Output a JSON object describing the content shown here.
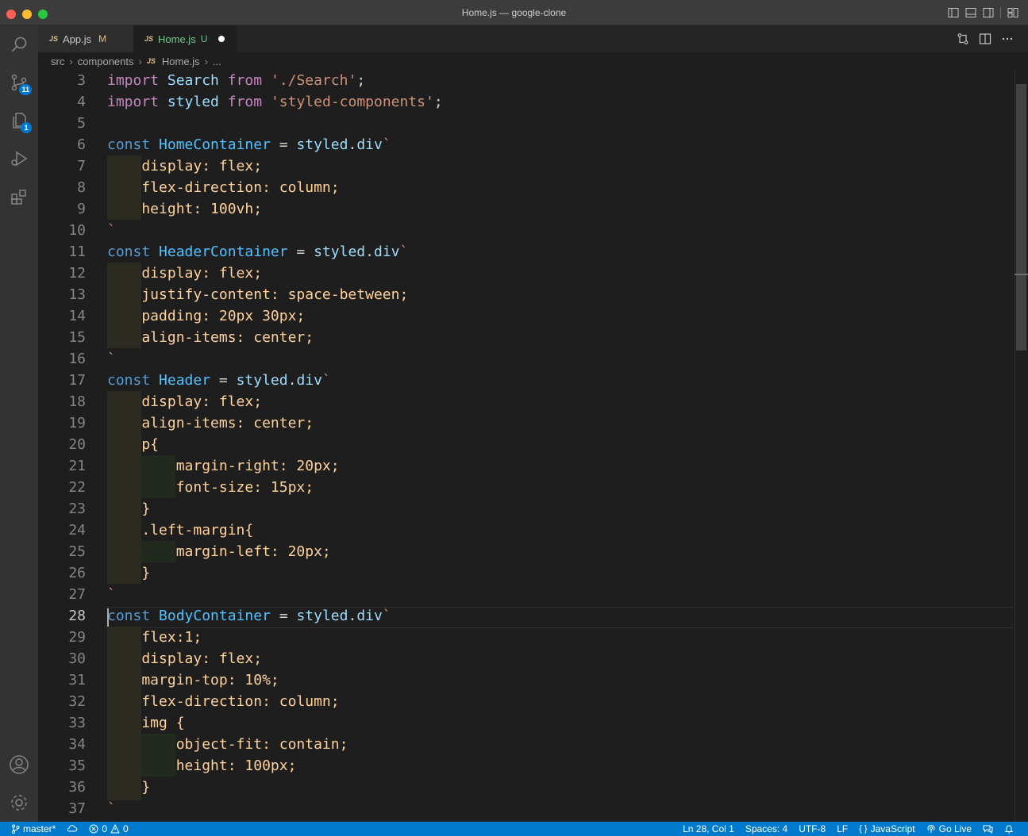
{
  "window": {
    "title": "Home.js — google-clone"
  },
  "activity_bar": {
    "source_control_badge": "11",
    "explorer_badge": "1"
  },
  "tabs": [
    {
      "label": "App.js",
      "status": "M",
      "icon": "JS"
    },
    {
      "label": "Home.js",
      "status": "U",
      "icon": "JS",
      "dirty": true
    }
  ],
  "breadcrumb": {
    "parts": [
      "src",
      "components",
      "Home.js",
      "..."
    ]
  },
  "editor": {
    "active_line": 28,
    "line_numbers": [
      "3",
      "4",
      "5",
      "6",
      "7",
      "8",
      "9",
      "10",
      "11",
      "12",
      "13",
      "14",
      "15",
      "16",
      "17",
      "18",
      "19",
      "20",
      "21",
      "22",
      "23",
      "24",
      "25",
      "26",
      "27",
      "28",
      "29",
      "30",
      "31",
      "32",
      "33",
      "34",
      "35",
      "36",
      "37"
    ]
  },
  "status_bar": {
    "branch": "master*",
    "errors": "0",
    "warnings": "0",
    "position": "Ln 28, Col 1",
    "spaces": "Spaces: 4",
    "encoding": "UTF-8",
    "eol": "LF",
    "language": "JavaScript",
    "go_live": "Go Live"
  },
  "colors": {
    "status_bar_bg": "#007acc",
    "keyword": "#569cd6",
    "keyword_control": "#c586c0",
    "string": "#ce9178",
    "css_text": "#ffd29a"
  }
}
